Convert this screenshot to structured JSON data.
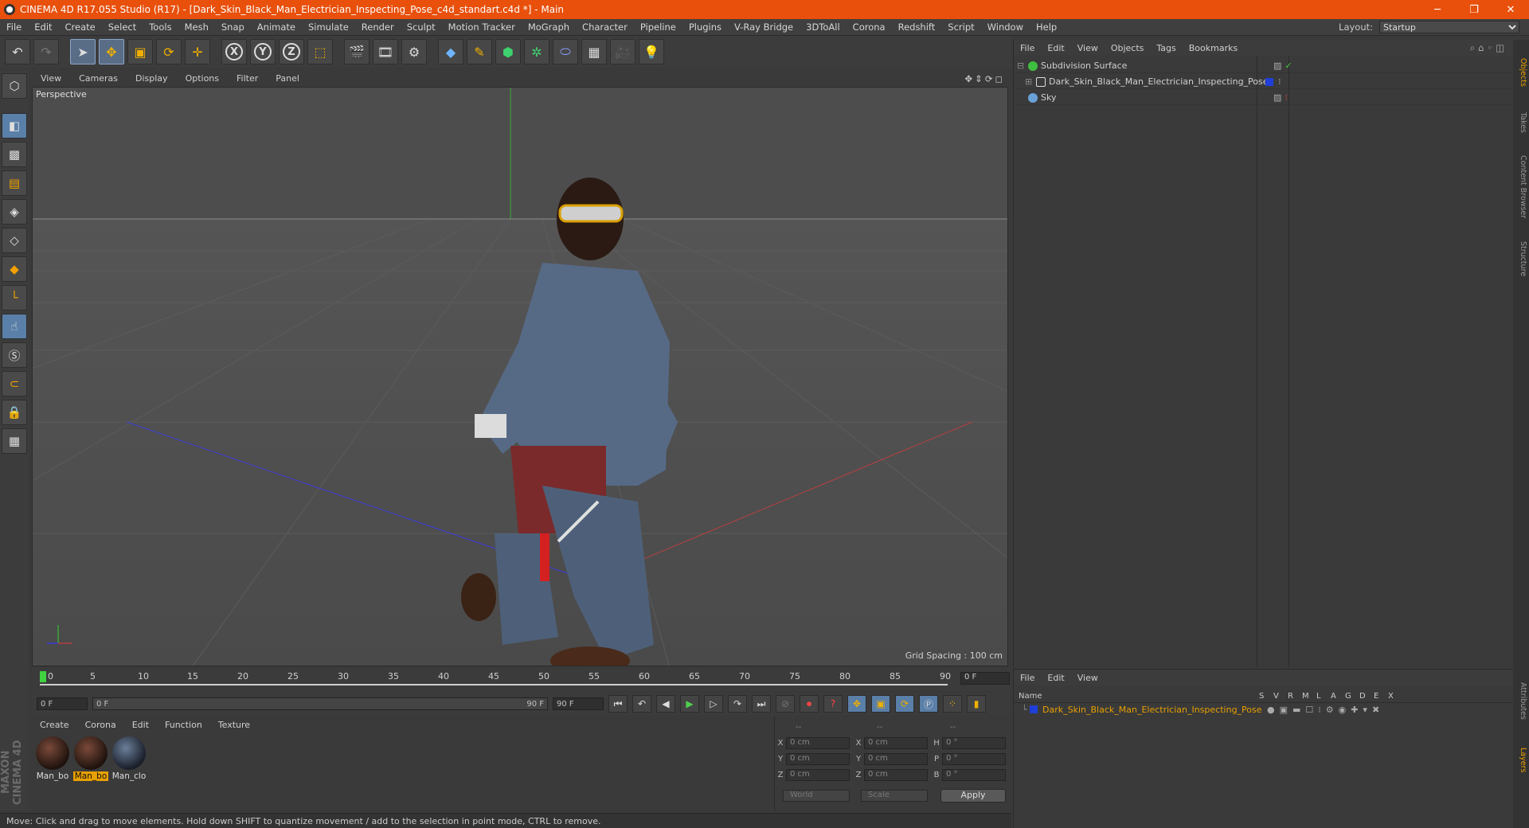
{
  "titlebar": {
    "title": "CINEMA 4D R17.055 Studio (R17) - [Dark_Skin_Black_Man_Electrician_Inspecting_Pose_c4d_standart.c4d *] - Main",
    "min": "─",
    "max": "❐",
    "close": "✕"
  },
  "menubar": {
    "items": [
      "File",
      "Edit",
      "Create",
      "Select",
      "Tools",
      "Mesh",
      "Snap",
      "Animate",
      "Simulate",
      "Render",
      "Sculpt",
      "Motion Tracker",
      "MoGraph",
      "Character",
      "Pipeline",
      "Plugins",
      "V-Ray Bridge",
      "3DToAll",
      "Corona",
      "Redshift",
      "Script",
      "Window",
      "Help"
    ],
    "layout_label": "Layout:",
    "layout_value": "Startup"
  },
  "viewport": {
    "menu": [
      "View",
      "Cameras",
      "Display",
      "Options",
      "Filter",
      "Panel"
    ],
    "label": "Perspective",
    "grid_spacing": "Grid Spacing : 100 cm"
  },
  "timeline": {
    "ticks": [
      "0",
      "5",
      "10",
      "15",
      "20",
      "25",
      "30",
      "35",
      "40",
      "45",
      "50",
      "55",
      "60",
      "65",
      "70",
      "75",
      "80",
      "85",
      "90"
    ],
    "current_frame": "0 F",
    "start_field": "0 F",
    "range_start": "0 F",
    "range_end": "90 F",
    "end_field": "90 F"
  },
  "materials": {
    "menu": [
      "Create",
      "Corona",
      "Edit",
      "Function",
      "Texture"
    ],
    "items": [
      {
        "name": "Man_bo"
      },
      {
        "name": "Man_bo"
      },
      {
        "name": "Man_clo"
      }
    ]
  },
  "coords": {
    "headers": [
      "--",
      "--",
      "--"
    ],
    "rows": [
      {
        "a": "X",
        "av": "0 cm",
        "b": "X",
        "bv": "0 cm",
        "c": "H",
        "cv": "0 °"
      },
      {
        "a": "Y",
        "av": "0 cm",
        "b": "Y",
        "bv": "0 cm",
        "c": "P",
        "cv": "0 °"
      },
      {
        "a": "Z",
        "av": "0 cm",
        "b": "Z",
        "bv": "0 cm",
        "c": "B",
        "cv": "0 °"
      }
    ],
    "world": "World",
    "scale": "Scale",
    "apply": "Apply"
  },
  "objects": {
    "menu": [
      "File",
      "Edit",
      "View",
      "Objects",
      "Tags",
      "Bookmarks"
    ],
    "rows": [
      {
        "name": "Subdivision Surface",
        "color": "#3fbf3f"
      },
      {
        "name": "Dark_Skin_Black_Man_Electrician_Inspecting_Pose",
        "color": "#dddddd"
      },
      {
        "name": "Sky",
        "color": "#6aa0d8"
      }
    ]
  },
  "attributes": {
    "menu": [
      "File",
      "Edit",
      "View"
    ],
    "col_name": "Name",
    "cols": [
      "S",
      "V",
      "R",
      "M",
      "L",
      "A",
      "G",
      "D",
      "E",
      "X"
    ],
    "row_name": "Dark_Skin_Black_Man_Electrician_Inspecting_Pose"
  },
  "siderail": [
    "Objects",
    "Takes",
    "Content Browser",
    "Structure",
    "Attributes",
    "Layers"
  ],
  "maxon": "MAXON CINEMA 4D",
  "status": "Move: Click and drag to move elements. Hold down SHIFT to quantize movement / add to the selection in point mode, CTRL to remove."
}
